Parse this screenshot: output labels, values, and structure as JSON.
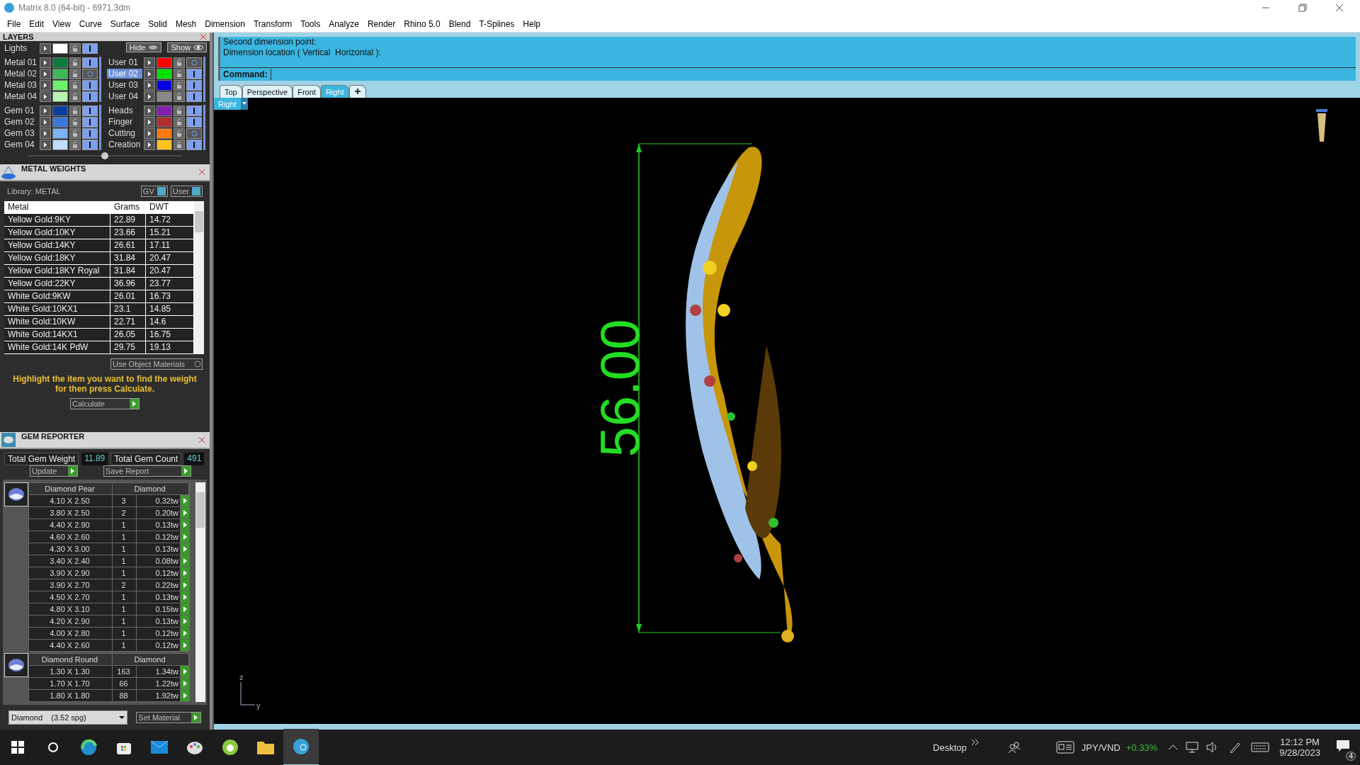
{
  "window": {
    "title": "Matrix 8.0 (64-bit) - 6971.3dm"
  },
  "menu": [
    "File",
    "Edit",
    "View",
    "Curve",
    "Surface",
    "Solid",
    "Mesh",
    "Dimension",
    "Transform",
    "Tools",
    "Analyze",
    "Render",
    "Rhino 5.0",
    "Blend",
    "T-Splines",
    "Help"
  ],
  "layers": {
    "title": "LAYERS",
    "hide_label": "Hide",
    "show_label": "Show",
    "lights": {
      "name": "Lights",
      "color": "#ffffff",
      "visible": true
    },
    "groups": [
      {
        "left": [
          {
            "name": "Metal 01",
            "color": "#0b7a3c",
            "visible": true,
            "selected": false
          },
          {
            "name": "Metal 02",
            "color": "#3fb85a",
            "visible": false,
            "selected": false
          },
          {
            "name": "Metal 03",
            "color": "#6ef06a",
            "visible": true,
            "selected": false
          },
          {
            "name": "Metal 04",
            "color": "#b8f5b0",
            "visible": true,
            "selected": false
          }
        ],
        "right": [
          {
            "name": "User 01",
            "color": "#ff0000",
            "visible": false,
            "selected": false
          },
          {
            "name": "User 02",
            "color": "#00e000",
            "visible": true,
            "selected": true
          },
          {
            "name": "User 03",
            "color": "#0000e0",
            "visible": true,
            "selected": false
          },
          {
            "name": "User 04",
            "color": "#888888",
            "visible": true,
            "selected": false
          }
        ]
      },
      {
        "left": [
          {
            "name": "Gem 01",
            "color": "#0a3fa0",
            "visible": true,
            "selected": false
          },
          {
            "name": "Gem 02",
            "color": "#3b78d8",
            "visible": true,
            "selected": false
          },
          {
            "name": "Gem 03",
            "color": "#7ab4f5",
            "visible": true,
            "selected": false
          },
          {
            "name": "Gem 04",
            "color": "#c0dcff",
            "visible": true,
            "selected": false
          }
        ],
        "right": [
          {
            "name": "Heads",
            "color": "#8020b0",
            "visible": true,
            "selected": false
          },
          {
            "name": "Finger",
            "color": "#b03030",
            "visible": true,
            "selected": false
          },
          {
            "name": "Cutting",
            "color": "#ff7a10",
            "visible": false,
            "selected": false
          },
          {
            "name": "Creation",
            "color": "#ffc020",
            "visible": true,
            "selected": false
          }
        ]
      }
    ]
  },
  "metal_weights": {
    "title": "METAL WEIGHTS",
    "library": "Library: METAL",
    "toggles": [
      "GV",
      "User"
    ],
    "columns": [
      "Metal",
      "Grams",
      "DWT"
    ],
    "rows": [
      [
        "Yellow Gold:9KY",
        "22.89",
        "14.72"
      ],
      [
        "Yellow Gold:10KY",
        "23.66",
        "15.21"
      ],
      [
        "Yellow Gold:14KY",
        "26.61",
        "17.11"
      ],
      [
        "Yellow Gold:18KY",
        "31.84",
        "20.47"
      ],
      [
        "Yellow Gold:18KY Royal",
        "31.84",
        "20.47"
      ],
      [
        "Yellow Gold:22KY",
        "36.96",
        "23.77"
      ],
      [
        "White Gold:9KW",
        "26.01",
        "16.73"
      ],
      [
        "White Gold:10KX1",
        "23.1",
        "14.85"
      ],
      [
        "White Gold:10KW",
        "22.71",
        "14.6"
      ],
      [
        "White Gold:14KX1",
        "26.05",
        "16.75"
      ],
      [
        "White Gold:14K PdW",
        "29.75",
        "19.13"
      ]
    ],
    "use_object_materials": "Use Object Materials",
    "hint": "Highlight the item you want to find the weight for then press Calculate.",
    "calculate": "Calculate"
  },
  "gem_reporter": {
    "title": "GEM REPORTER",
    "total_weight_label": "Total Gem Weight",
    "total_weight": "11.89",
    "total_count_label": "Total Gem Count",
    "total_count": "491",
    "update": "Update",
    "save_report": "Save Report",
    "groups": [
      {
        "name": "Diamond Pear",
        "material": "Diamond",
        "rows": [
          {
            "size": "4.10 X 2.50",
            "count": "3",
            "weight": "0.32tw"
          },
          {
            "size": "3.80 X 2.50",
            "count": "2",
            "weight": "0.20tw"
          },
          {
            "size": "4.40 X 2.90",
            "count": "1",
            "weight": "0.13tw"
          },
          {
            "size": "4.60 X 2.60",
            "count": "1",
            "weight": "0.12tw"
          },
          {
            "size": "4.30 X 3.00",
            "count": "1",
            "weight": "0.13tw"
          },
          {
            "size": "3.40 X 2.40",
            "count": "1",
            "weight": "0.08tw"
          },
          {
            "size": "3.90 X 2.90",
            "count": "1",
            "weight": "0.12tw"
          },
          {
            "size": "3.90 X 2.70",
            "count": "2",
            "weight": "0.22tw"
          },
          {
            "size": "4.50 X 2.70",
            "count": "1",
            "weight": "0.13tw"
          },
          {
            "size": "4.80 X 3.10",
            "count": "1",
            "weight": "0.15tw"
          },
          {
            "size": "4.20 X 2.90",
            "count": "1",
            "weight": "0.13tw"
          },
          {
            "size": "4.00 X 2.80",
            "count": "1",
            "weight": "0.12tw"
          },
          {
            "size": "4.40 X 2.60",
            "count": "1",
            "weight": "0.12tw"
          }
        ]
      },
      {
        "name": "Diamond Round",
        "material": "Diamond",
        "rows": [
          {
            "size": "1.30 X 1.30",
            "count": "163",
            "weight": "1.34tw"
          },
          {
            "size": "1.70 X 1.70",
            "count": "66",
            "weight": "1.22tw"
          },
          {
            "size": "1.80 X 1.80",
            "count": "88",
            "weight": "1.92tw"
          }
        ]
      }
    ],
    "material_select": "Diamond    (3.52 spg)",
    "set_material": "Set Material"
  },
  "command": {
    "history": [
      "Second dimension point:",
      "Dimension location ( Vertical  Horizontal ):"
    ],
    "prompt": "Command:"
  },
  "view_tabs": [
    {
      "label": "Top",
      "selected": false
    },
    {
      "label": "Perspective",
      "selected": false
    },
    {
      "label": "Front",
      "selected": false
    },
    {
      "label": "Right",
      "selected": true
    }
  ],
  "viewport": {
    "label": "Right",
    "dimension": "56.00",
    "axis_z": "z",
    "axis_y": "y"
  },
  "taskbar": {
    "desktop": "Desktop",
    "ticker": "JPY/VND",
    "change": "+0.33%",
    "time": "12:12 PM",
    "date": "9/28/2023",
    "notifications": "4"
  }
}
